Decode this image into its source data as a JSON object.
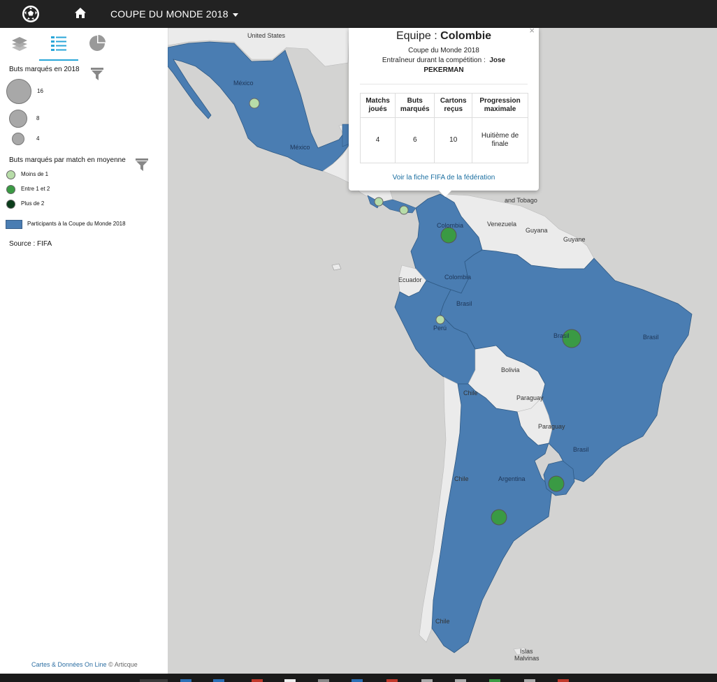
{
  "app": {
    "title": "COUPE DU MONDE 2018"
  },
  "sidebar": {
    "tabs": [
      {
        "name": "layers-icon",
        "active": false
      },
      {
        "name": "legend-icon",
        "active": true
      },
      {
        "name": "chart-icon",
        "active": false
      }
    ],
    "size_legend": {
      "title": "Buts marqués en 2018",
      "items": [
        {
          "label": "16"
        },
        {
          "label": "8"
        },
        {
          "label": "4"
        }
      ]
    },
    "color_legend": {
      "title": "Buts marqués par match en moyenne",
      "items": [
        {
          "label": "Moins de 1",
          "color": "#b7dca8"
        },
        {
          "label": "Entre 1 et 2",
          "color": "#3a9a44"
        },
        {
          "label": "Plus de 2",
          "color": "#0b3d1b"
        }
      ]
    },
    "area_legend": {
      "label": "Participants à la Coupe du Monde 2018",
      "color": "#4a7db2"
    },
    "source": "Source : FIFA",
    "footer": {
      "link": "Cartes & Données On Line",
      "copyright": "© Articque"
    }
  },
  "map": {
    "labels": [
      {
        "text": "United States"
      },
      {
        "text": "México"
      },
      {
        "text": "México"
      },
      {
        "text": "Colombia"
      },
      {
        "text": "Colombia"
      },
      {
        "text": "Venezuela"
      },
      {
        "text": "Guyana"
      },
      {
        "text": "Guyane"
      },
      {
        "text": "and Tobago"
      },
      {
        "text": "Ecuador"
      },
      {
        "text": "Perú"
      },
      {
        "text": "Brasil"
      },
      {
        "text": "Brasil"
      },
      {
        "text": "Brasil"
      },
      {
        "text": "Brasil"
      },
      {
        "text": "Bolivia"
      },
      {
        "text": "Paraguay"
      },
      {
        "text": "Paraguay"
      },
      {
        "text": "Chile"
      },
      {
        "text": "Chile"
      },
      {
        "text": "Chile"
      },
      {
        "text": "Argentina"
      },
      {
        "text": "Islas"
      },
      {
        "text": "Malvinas"
      }
    ],
    "colors": {
      "participant": "#4a7db2",
      "land": "#ebebeb",
      "water": "#d3d3d2"
    }
  },
  "popup": {
    "title_prefix": "Equipe :",
    "team": "Colombie",
    "subtitle": "Coupe du Monde 2018",
    "coach_label": "Entraîneur durant la compétition :",
    "coach_first": "Jose",
    "coach_last": "PEKERMAN",
    "close": "×",
    "table": {
      "headers": [
        "Matchs joués",
        "Buts marqués",
        "Cartons reçus",
        "Progression maximale"
      ],
      "values": [
        "4",
        "6",
        "10",
        "Huitième de finale"
      ]
    },
    "link": "Voir la fiche FIFA de la fédération"
  }
}
